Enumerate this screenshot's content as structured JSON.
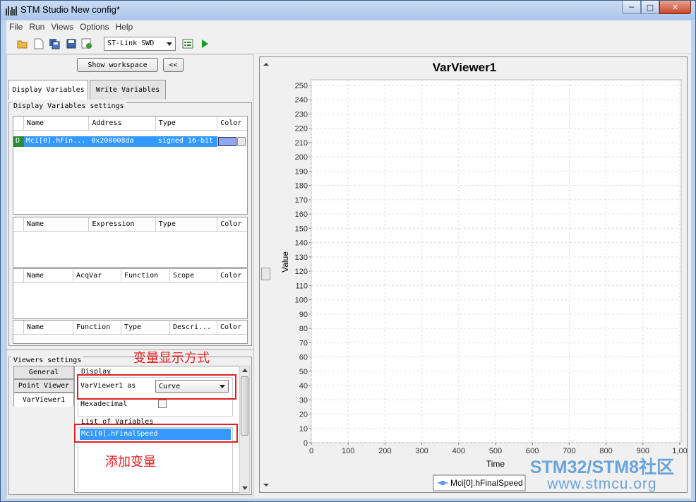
{
  "window": {
    "title": "STM Studio New config*"
  },
  "menu": [
    "File",
    "Run",
    "Views",
    "Options",
    "Help"
  ],
  "toolbar": {
    "probe_value": "ST-Link SWD"
  },
  "left": {
    "show_workspace_label": "Show workspace",
    "collapse_label": "<<",
    "tabs": [
      "Display Variables",
      "Write Variables"
    ],
    "group_title": "Display Variables settings",
    "table1": {
      "headers": [
        "Name",
        "Address",
        "Type",
        "Color"
      ],
      "rows": [
        {
          "flag": "D",
          "name": "Mci[0].hFin...",
          "address": "0x200008da",
          "type": "signed 16-bit",
          "color": "#8fa8f0"
        }
      ]
    },
    "table2": {
      "headers": [
        "Name",
        "Expression",
        "Type",
        "Color"
      ]
    },
    "table3": {
      "headers": [
        "Name",
        "AcqVar",
        "Function",
        "Scope",
        "Color"
      ]
    },
    "table4": {
      "headers": [
        "Name",
        "Function",
        "Type",
        "Descri...",
        "Color"
      ]
    },
    "viewers_title": "Viewers settings",
    "viewer_tabs": [
      "General",
      "Point Viewer",
      "VarViewer1"
    ],
    "display_title": "Display",
    "viewer_as_label": "VarViewer1 as",
    "viewer_as_value": "Curve",
    "hex_label": "Hexadecimal",
    "list_title": "List of Variables",
    "list_items": [
      "Mci[0].hFinalSpeed"
    ]
  },
  "annotations": {
    "display_mode": "变量显示方式",
    "add_variable": "添加变量"
  },
  "chart_data": {
    "type": "line",
    "title": "VarViewer1",
    "xlabel": "Time",
    "ylabel": "Value",
    "xlim": [
      0,
      1000
    ],
    "ylim": [
      0,
      250
    ],
    "xticks": [
      "0",
      "100",
      "200",
      "300",
      "400",
      "500",
      "600",
      "700",
      "800",
      "900",
      "1,00"
    ],
    "yticks": [
      "0",
      "10",
      "20",
      "30",
      "40",
      "50",
      "60",
      "70",
      "80",
      "90",
      "100",
      "110",
      "120",
      "130",
      "140",
      "150",
      "160",
      "170",
      "180",
      "190",
      "200",
      "210",
      "220",
      "230",
      "240",
      "250"
    ],
    "grid": true,
    "legend": "bottom",
    "series": [
      {
        "name": "Mci[0].hFinalSpeed",
        "color": "#6699ff",
        "values": []
      }
    ]
  },
  "watermark": {
    "line1": "STM32/STM8社区",
    "line2": "www.stmcu.org"
  },
  "colors": {
    "selection": "#3399ff",
    "annotation": "#e02020",
    "title_bar": "#bcd3ee"
  }
}
